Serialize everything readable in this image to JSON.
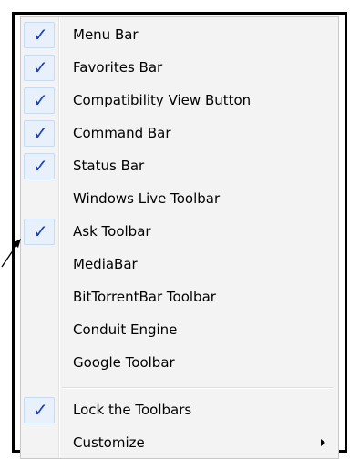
{
  "menu": {
    "items": [
      {
        "label": "Menu Bar",
        "checked": true
      },
      {
        "label": "Favorites Bar",
        "checked": true
      },
      {
        "label": "Compatibility View Button",
        "checked": true
      },
      {
        "label": "Command Bar",
        "checked": true
      },
      {
        "label": "Status Bar",
        "checked": true
      },
      {
        "label": "Windows Live Toolbar",
        "checked": false
      },
      {
        "label": "Ask Toolbar",
        "checked": true
      },
      {
        "label": "MediaBar",
        "checked": false
      },
      {
        "label": "BitTorrentBar Toolbar",
        "checked": false
      },
      {
        "label": "Conduit Engine",
        "checked": false
      },
      {
        "label": "Google Toolbar",
        "checked": false
      }
    ],
    "lower_items": [
      {
        "label": "Lock the Toolbars",
        "checked": true
      },
      {
        "label": "Customize",
        "checked": false,
        "has_submenu": true
      }
    ],
    "check_glyph": "✓",
    "colors": {
      "check": "#1d3fb8",
      "check_background": "#e8f1fb",
      "menu_background": "#f3f3f3"
    }
  }
}
